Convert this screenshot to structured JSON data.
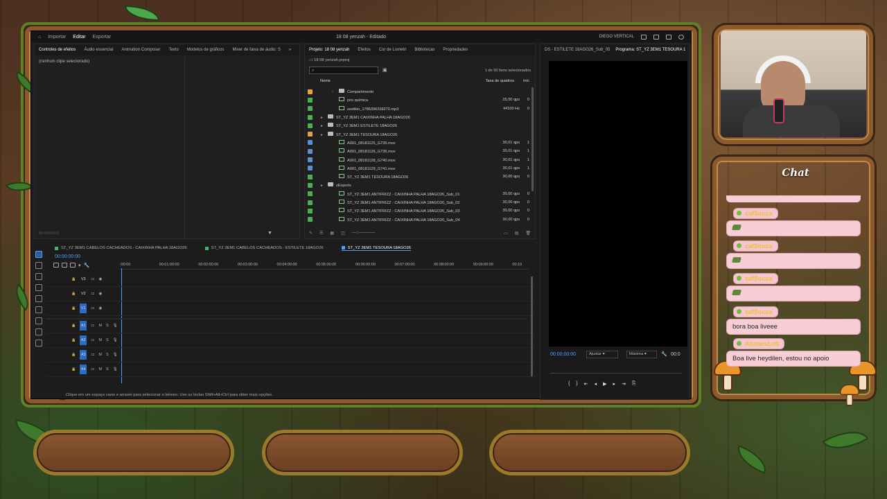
{
  "app": {
    "menu_tabs": [
      "Importar",
      "Editar",
      "Exportar"
    ],
    "active_tab": "Editar",
    "title": "18 08 yenzah - Editado",
    "workspace": "DIEGO VERTICAL"
  },
  "effects_panel": {
    "tabs": [
      "Controles de efeitos",
      "Áudio essencial",
      "Animation Composer",
      "Texto",
      "Modelos de gráficos",
      "Mixer de faixa de áudio: S"
    ],
    "empty_label": "(nenhum clipe selecionado)",
    "timecode": "00:00:00:00"
  },
  "project_panel": {
    "tabs": [
      "Projeto: 18 08 yenzah",
      "Efeitos",
      "Cor de Lumetri",
      "Bibliotecas",
      "Propriedades"
    ],
    "file": "18 08 yenzah.prproj",
    "selection_count": "1 de 50 itens selecionados",
    "col_name": "Nome",
    "col_rate": "Taxa de quadros",
    "col_in": "Iníc",
    "items": [
      {
        "kind": "folder",
        "indent": 2,
        "name": "Compartimento",
        "rate": "",
        "in": "",
        "color": "#e8a33a"
      },
      {
        "kind": "clip",
        "indent": 2,
        "name": "pos química",
        "rate": "25,00 qps",
        "in": "0",
        "color": "#4caf50"
      },
      {
        "kind": "clip",
        "indent": 2,
        "name": "ssstikio_1786396339270.mp3",
        "rate": "44100 Hz",
        "in": "0",
        "color": "#4caf50"
      },
      {
        "kind": "folder",
        "indent": 1,
        "name": "ST_YZ 3EM1 CAIXINHA PALHA 18AGO26",
        "rate": "",
        "in": "",
        "color": "#4caf50"
      },
      {
        "kind": "folder",
        "indent": 1,
        "name": "ST_YZ 3EM1 ESTILETE 18AGO26",
        "rate": "",
        "in": "",
        "color": "#4caf50"
      },
      {
        "kind": "folder",
        "indent": 1,
        "name": "ST_YZ 3EM1 TESOURA 18AGO26",
        "rate": "",
        "in": "",
        "color": "#e8a33a"
      },
      {
        "kind": "clip",
        "indent": 2,
        "name": "A001_08181125_G735.mov",
        "rate": "30,01 qps",
        "in": "1",
        "color": "#5b8fd1"
      },
      {
        "kind": "clip",
        "indent": 2,
        "name": "A001_08181126_G736.mov",
        "rate": "30,01 qps",
        "in": "1",
        "color": "#5b8fd1"
      },
      {
        "kind": "clip",
        "indent": 2,
        "name": "A001_08181128_G740.mov",
        "rate": "30,01 qps",
        "in": "1",
        "color": "#5b8fd1"
      },
      {
        "kind": "clip",
        "indent": 2,
        "name": "A001_08181129_G741.mov",
        "rate": "30,01 qps",
        "in": "1",
        "color": "#5b8fd1"
      },
      {
        "kind": "clip",
        "indent": 2,
        "name": "ST_YZ 3EM1 TESOURA 18AGO26",
        "rate": "30,00 qps",
        "in": "0",
        "color": "#4caf50"
      },
      {
        "kind": "folder",
        "indent": 1,
        "name": "zExports",
        "rate": "",
        "in": "",
        "color": "#4caf50"
      },
      {
        "kind": "clip",
        "indent": 2,
        "name": "ST_YZ 3EM1 ANTIFRIZZ - CAIXINHA PALHA 18AGO26_Sub_01",
        "rate": "30,00 qps",
        "in": "0",
        "color": "#4caf50"
      },
      {
        "kind": "clip",
        "indent": 2,
        "name": "ST_YZ 3EM1 ANTIFRIZZ - CAIXINHA PALHA 18AGO26_Sub_02",
        "rate": "30,00 qps",
        "in": "0",
        "color": "#4caf50"
      },
      {
        "kind": "clip",
        "indent": 2,
        "name": "ST_YZ 3EM1 ANTIFRIZZ - CAIXINHA PALHA 18AGO26_Sub_03",
        "rate": "30,00 qps",
        "in": "0",
        "color": "#4caf50"
      },
      {
        "kind": "clip",
        "indent": 2,
        "name": "ST_YZ 3EM1 ANTIFRIZZ - CAIXINHA PALHA 18AGO26_Sub_04",
        "rate": "30,00 qps",
        "in": "0",
        "color": "#4caf50"
      }
    ]
  },
  "program_monitor": {
    "source_tab": "DS - ESTILETE 18AGO26_Sub_05",
    "program_tab": "Programa: ST_YZ 3EM1 TESOURA 1",
    "timecode": "00:00:00:00",
    "fit": "Ajustar",
    "quality": "Máxima",
    "end_timecode": "00:0"
  },
  "timeline": {
    "sequences": [
      "ST_YZ 3EM1 CABELOS CACHEADOS - CAIXINHA PALHA 18AGO26",
      "ST_YZ 3EM1 CABELOS CACHEADOS - ESTILETE 18AGO26",
      "ST_YZ 3EM1 TESOURA 18AGO26"
    ],
    "active_sequence": 2,
    "timecode": "00:00:00:00",
    "ruler": [
      ":00:00",
      "00:01:00:00",
      "00:02:00:00",
      "00:03:00:00",
      "00:04:00:00",
      "00:05:00:00",
      "00:06:00:00",
      "00:07:00:00",
      "00:08:00:00",
      "00:09:00:00",
      "00:10"
    ],
    "video_tracks": [
      "V3",
      "V2",
      "V1"
    ],
    "audio_tracks": [
      "A1",
      "A2",
      "A3",
      "A4"
    ],
    "mute_label": "M",
    "solo_label": "S"
  },
  "status_bar": "Clique em um espaço vazio e arraste para selecionar o letreiro. Use as teclas Shift+Alt+Ctrl para obter mais opções.",
  "chat": {
    "title": "Chat",
    "messages": [
      {
        "user": "cafSouza",
        "text": "",
        "emote": true
      },
      {
        "user": "cafSouza",
        "text": "",
        "emote": true
      },
      {
        "user": "cafSouza",
        "text": "",
        "emote": true
      },
      {
        "user": "cafSouza",
        "text": "bora boa liveee",
        "emote": false
      },
      {
        "user": "AnimesLofi",
        "text": "Boa live heydilen, estou no apoio",
        "emote": false
      }
    ]
  }
}
